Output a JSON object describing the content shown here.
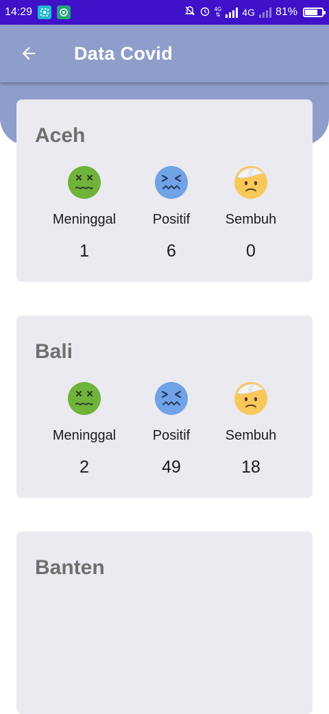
{
  "status_bar": {
    "time": "14:29",
    "network": "4G",
    "network_small_top": "4G",
    "battery": "81%",
    "battery_level": 0.81
  },
  "app_bar": {
    "title": "Data Covid",
    "back_icon": "arrow-left-icon"
  },
  "provinces": [
    {
      "name": "Aceh",
      "stats": [
        {
          "label": "Meninggal",
          "value": "1",
          "icon": "dead-face-icon"
        },
        {
          "label": "Positif",
          "value": "6",
          "icon": "sick-face-icon"
        },
        {
          "label": "Sembuh",
          "value": "0",
          "icon": "bandaged-face-icon"
        }
      ]
    },
    {
      "name": "Bali",
      "stats": [
        {
          "label": "Meninggal",
          "value": "2",
          "icon": "dead-face-icon"
        },
        {
          "label": "Positif",
          "value": "49",
          "icon": "sick-face-icon"
        },
        {
          "label": "Sembuh",
          "value": "18",
          "icon": "bandaged-face-icon"
        }
      ]
    },
    {
      "name": "Banten",
      "stats": []
    }
  ],
  "colors": {
    "status_bar": "#3f12c9",
    "app_bar": "#8f9dca",
    "card": "#ebeaf1",
    "dead": "#6fb33a",
    "sick": "#6fa3e6",
    "recovered": "#f9c85a"
  }
}
